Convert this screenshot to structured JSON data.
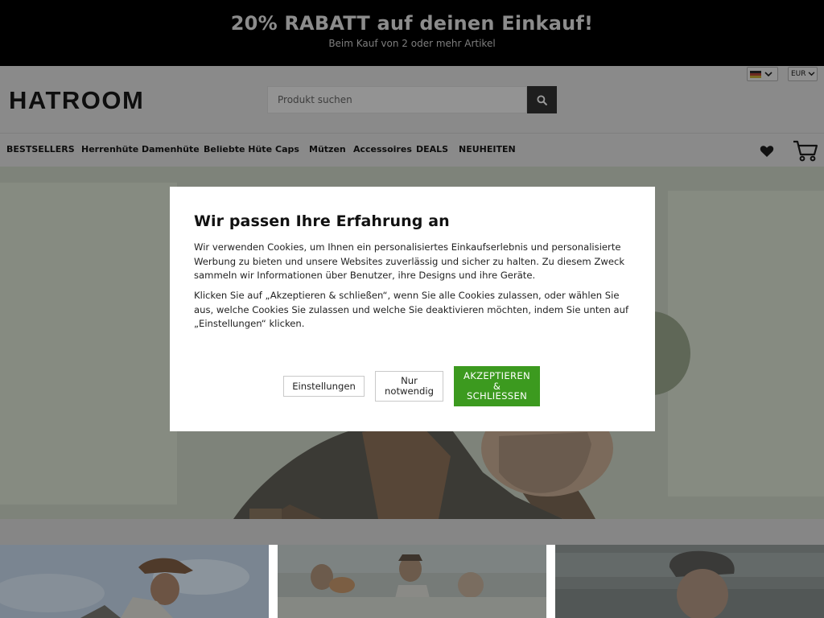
{
  "promo": {
    "title": "20% RABATT auf deinen Einkauf!",
    "subtitle": "Beim Kauf von 2 oder mehr Artikel"
  },
  "header": {
    "logo": "HATROOM",
    "search_placeholder": "Produkt suchen",
    "search_icon": "search-icon",
    "language_flag": "flag-germany",
    "currency": "EUR"
  },
  "nav": {
    "items": [
      "BESTSELLERS",
      "Herrenhüte",
      "Damenhüte",
      "Beliebte Hüte",
      "Caps",
      "Mützen",
      "Accessoires",
      "DEALS",
      "NEUHEITEN"
    ],
    "wishlist_icon": "heart-icon",
    "cart_icon": "cart-icon"
  },
  "cookie_dialog": {
    "title": "Wir passen Ihre Erfahrung an",
    "paragraph1": "Wir verwenden Cookies, um Ihnen ein personalisiertes Einkaufserlebnis und personalisierte Werbung zu bieten und unsere Websites zuverlässig und sicher zu halten. Zu diesem Zweck sammeln wir Informationen über Benutzer, ihre Designs und ihre Geräte.",
    "paragraph2": "Klicken Sie auf „Akzeptieren & schließen“, wenn Sie alle Cookies zulassen, oder wählen Sie aus, welche Cookies Sie zulassen und welche Sie deaktivieren möchten, indem Sie unten auf „Einstellungen“ klicken.",
    "settings_label": "Einstellungen",
    "necessary_label": "Nur\nnotwendig",
    "accept_label": "AKZEPTIEREN\n&\nSCHLIESSEN"
  },
  "colors": {
    "accent_green": "#3c9a1f",
    "promo_bg": "#000000"
  }
}
